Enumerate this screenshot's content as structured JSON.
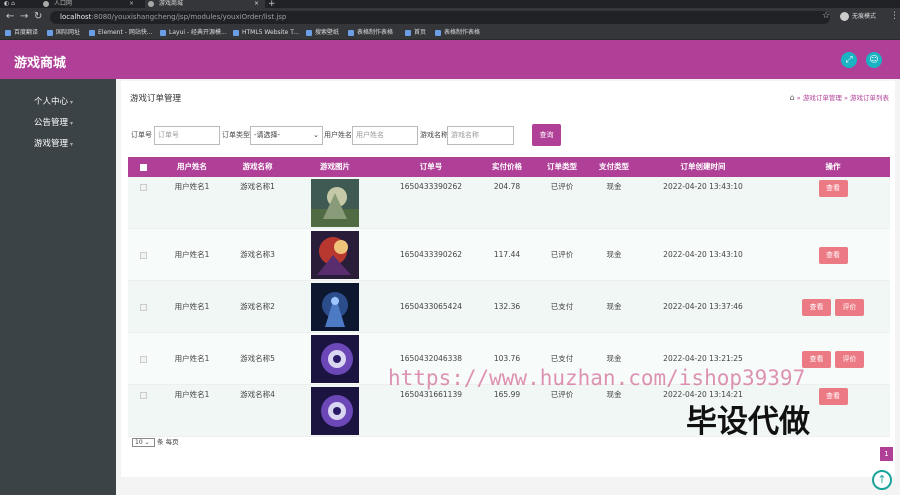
{
  "browser": {
    "tabs": [
      {
        "title": "人口网"
      },
      {
        "title": "游戏商城"
      }
    ],
    "url_host": "localhost",
    "url_rest": ":8080/youxishangcheng/jsp/modules/youxiOrder/list.jsp",
    "profile_label": "无痕模式",
    "bookmarks": [
      "百度翻译",
      "国际网址",
      "Element - 网站快...",
      "Layui - 经典开源模...",
      "HTML5 Website T...",
      "搜索壁纸",
      "表格制作表格",
      "首页",
      "表格制作表格"
    ]
  },
  "app": {
    "title": "游戏商城",
    "colors": {
      "brand": "#b03f98",
      "sidebar": "#3c4347",
      "header_icon": "#1ab3c4",
      "action_button": "#ec7a84"
    },
    "header_icons": [
      "expand-icon",
      "user-icon"
    ]
  },
  "sidebar": {
    "items": [
      {
        "label": "个人中心"
      },
      {
        "label": "公告管理"
      },
      {
        "label": "游戏管理"
      }
    ]
  },
  "page": {
    "title": "游戏订单管理",
    "breadcrumb": [
      "游戏订单管理",
      "游戏订单列表"
    ]
  },
  "filters": {
    "order_no_label": "订单号",
    "order_no_placeholder": "订单号",
    "order_type_label": "订单类型",
    "order_type_value": "-请选择-",
    "username_label": "用户姓名",
    "username_placeholder": "用户姓名",
    "game_name_label": "游戏名称",
    "game_name_placeholder": "游戏名称",
    "search_label": "查询"
  },
  "table": {
    "columns": [
      "用户姓名",
      "游戏名称",
      "游戏图片",
      "订单号",
      "实付价格",
      "订单类型",
      "支付类型",
      "订单创建时间",
      "操作"
    ],
    "rows": [
      {
        "user": "用户姓名1",
        "game": "游戏名称1",
        "order_no": "1650433390262",
        "price": "204.78",
        "order_type": "已评价",
        "pay_type": "现金",
        "created": "2022-04-20 13:43:10",
        "actions": [
          "查看"
        ],
        "vtop": true
      },
      {
        "user": "用户姓名1",
        "game": "游戏名称3",
        "order_no": "1650433390262",
        "price": "117.44",
        "order_type": "已评价",
        "pay_type": "现金",
        "created": "2022-04-20 13:43:10",
        "actions": [
          "查看"
        ],
        "vtop": false
      },
      {
        "user": "用户姓名1",
        "game": "游戏名称2",
        "order_no": "1650433065424",
        "price": "132.36",
        "order_type": "已支付",
        "pay_type": "现金",
        "created": "2022-04-20 13:37:46",
        "actions": [
          "查看",
          "评价"
        ],
        "vtop": false
      },
      {
        "user": "用户姓名1",
        "game": "游戏名称5",
        "order_no": "1650432046338",
        "price": "103.76",
        "order_type": "已支付",
        "pay_type": "现金",
        "created": "2022-04-20 13:21:25",
        "actions": [
          "查看",
          "评价"
        ],
        "vtop": false
      },
      {
        "user": "用户姓名1",
        "game": "游戏名称4",
        "order_no": "1650431661139",
        "price": "165.99",
        "order_type": "已评价",
        "pay_type": "现金",
        "created": "2022-04-20 13:14:21",
        "actions": [
          "查看"
        ],
        "vtop": true
      }
    ]
  },
  "pagination": {
    "page_size": "10",
    "per_page_label": "条 每页",
    "current_page": "1"
  },
  "overlay": {
    "watermark": "https://www.huzhan.com/ishop39397",
    "stamp": "毕设代做"
  }
}
